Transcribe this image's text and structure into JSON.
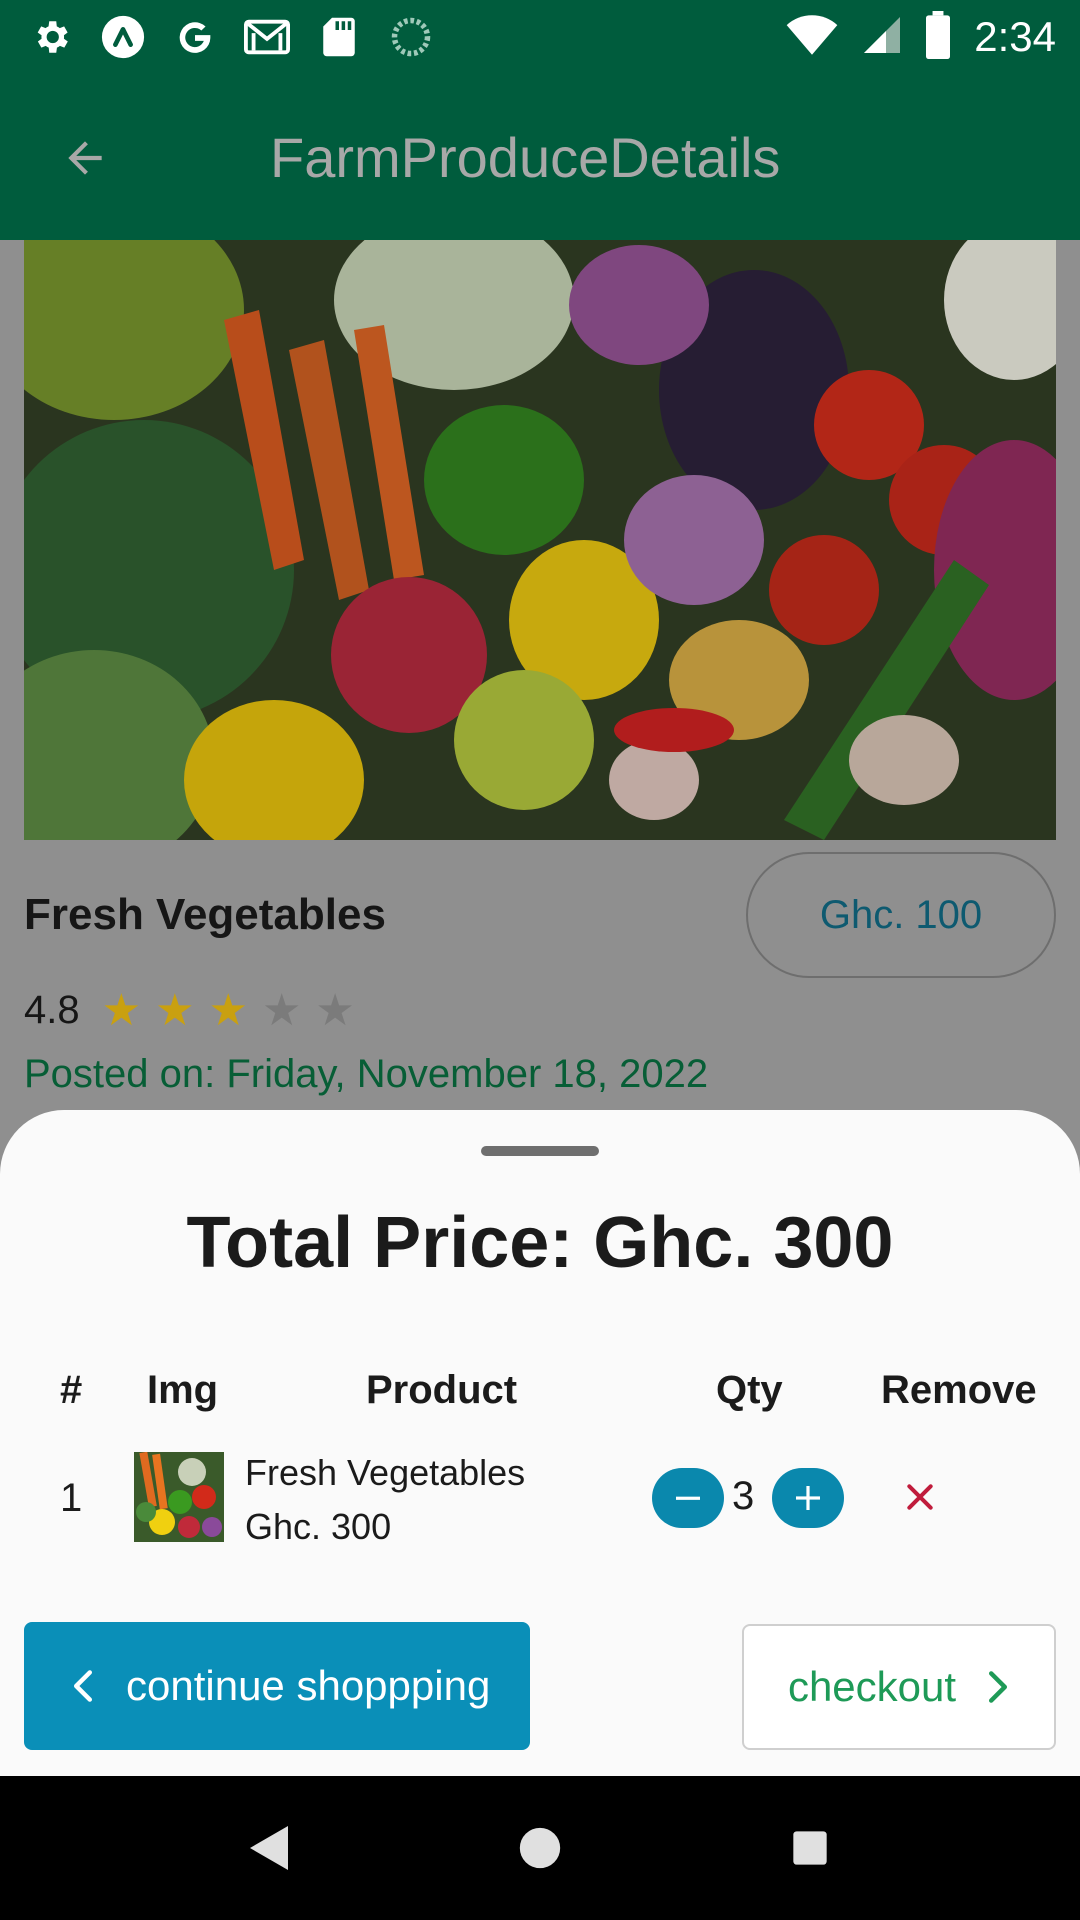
{
  "status_bar": {
    "time": "2:34",
    "icons": [
      "settings-icon",
      "app-a-icon",
      "google-icon",
      "gmail-icon",
      "sd-card-icon",
      "loading-icon",
      "wifi-icon",
      "signal-icon",
      "battery-icon"
    ]
  },
  "app_bar": {
    "title": "FarmProduceDetails",
    "back_icon": "arrow-back-icon"
  },
  "product": {
    "name": "Fresh Vegetables",
    "price": "Ghc. 100",
    "rating": "4.8",
    "stars_filled": 3,
    "stars_total": 5,
    "posted": "Posted on: Friday, November 18, 2022",
    "image": "vegetables-photo"
  },
  "cart_sheet": {
    "total": "Total Price: Ghc. 300",
    "headers": [
      "#",
      "Img",
      "Product",
      "Qty",
      "Remove"
    ],
    "rows": [
      {
        "index": "1",
        "name": "Fresh Vegetables",
        "price": "Ghc. 300",
        "qty": "3"
      }
    ],
    "continue_label": "continue shoppping",
    "checkout_label": "checkout"
  },
  "colors": {
    "primary_dark": "#005c3d",
    "accent_blue": "#0a8fb8",
    "checkout_green": "#1e9a57",
    "star_gold": "#c9a010",
    "remove_red": "#c01c3c"
  }
}
